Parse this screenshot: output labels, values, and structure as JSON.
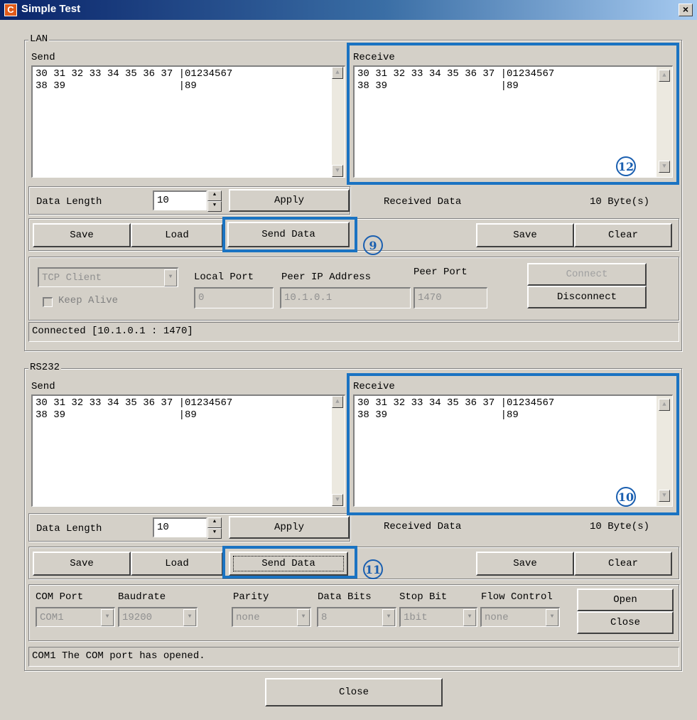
{
  "window": {
    "title": "Simple Test",
    "icon_letter": "C",
    "close_glyph": "×"
  },
  "lan": {
    "legend": "LAN",
    "send_label": "Send",
    "receive_label": "Receive",
    "send_text": "30 31 32 33 34 35 36 37 |01234567\n38 39                   |89",
    "receive_text": "30 31 32 33 34 35 36 37 |01234567\n38 39                   |89",
    "data_length_label": "Data Length",
    "data_length_value": "10",
    "apply": "Apply",
    "received_data_label": "Received Data",
    "received_bytes": "10  Byte(s)",
    "save": "Save",
    "load": "Load",
    "send_data": "Send Data",
    "rx_save": "Save",
    "clear": "Clear",
    "mode": "TCP Client",
    "keep_alive": "Keep Alive",
    "local_port_label": "Local Port",
    "local_port": "0",
    "peer_ip_label": "Peer IP Address",
    "peer_ip": "10.1.0.1",
    "peer_port_label": "Peer Port",
    "peer_port": "1470",
    "connect": "Connect",
    "disconnect": "Disconnect",
    "status": "Connected [10.1.0.1 : 1470]"
  },
  "rs232": {
    "legend": "RS232",
    "send_label": "Send",
    "receive_label": "Receive",
    "send_text": "30 31 32 33 34 35 36 37 |01234567\n38 39                   |89",
    "receive_text": "30 31 32 33 34 35 36 37 |01234567\n38 39                   |89",
    "data_length_label": "Data Length",
    "data_length_value": "10",
    "apply": "Apply",
    "received_data_label": "Received Data",
    "received_bytes": "10  Byte(s)",
    "save": "Save",
    "load": "Load",
    "send_data": "Send Data",
    "rx_save": "Save",
    "clear": "Clear",
    "com_port_label": "COM Port",
    "com_port": "COM1",
    "baudrate_label": "Baudrate",
    "baudrate": "19200",
    "parity_label": "Parity",
    "parity": "none",
    "data_bits_label": "Data Bits",
    "data_bits": "8",
    "stop_bit_label": "Stop Bit",
    "stop_bit": "1bit",
    "flow_control_label": "Flow Control",
    "flow_control": "none",
    "open": "Open",
    "close": "Close",
    "status": "COM1 The COM port has opened."
  },
  "footer": {
    "close": "Close"
  },
  "annotations": {
    "a9": "9",
    "a10": "10",
    "a11": "11",
    "a12": "12"
  },
  "colors": {
    "highlight": "#1a73c2",
    "title_gradient_start": "#0a246a",
    "dialog_bg": "#d4d0c8"
  }
}
